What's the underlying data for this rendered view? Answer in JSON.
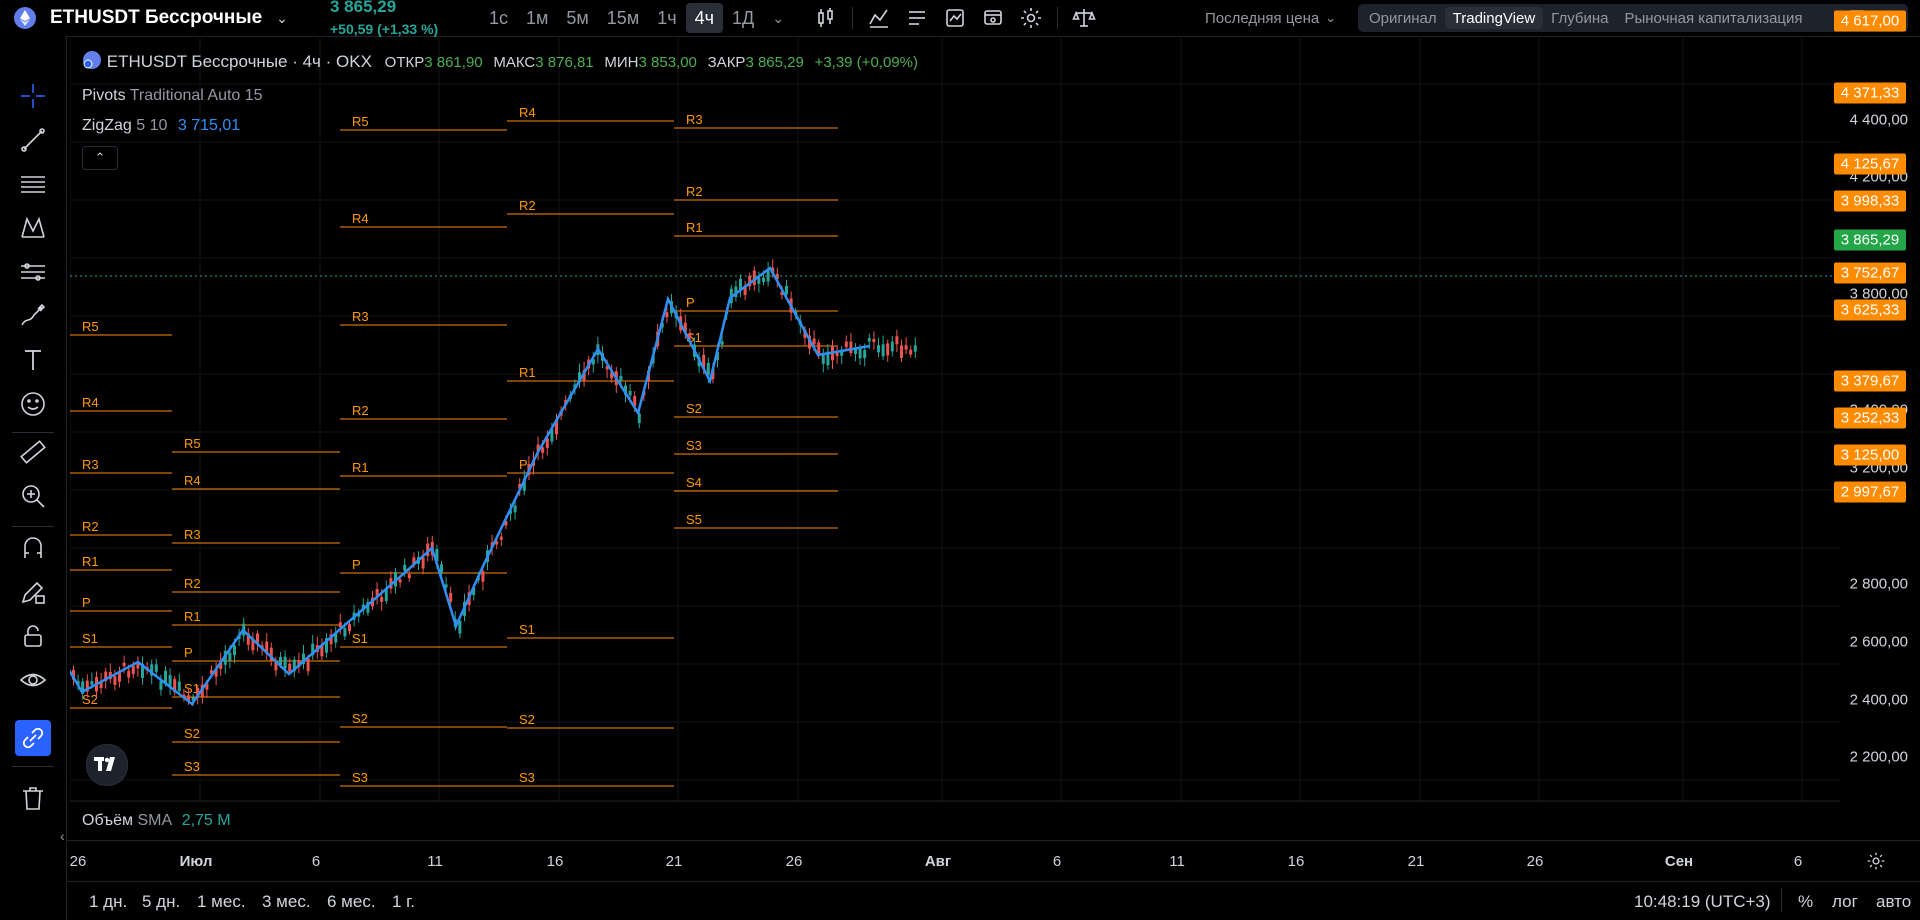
{
  "header": {
    "symbol": "ETHUSDT Бессрочные",
    "last_price": "3 865,29",
    "change": "+50,59 (+1,33 %)",
    "timeframes": [
      "1с",
      "1м",
      "5м",
      "15м",
      "1ч",
      "4ч",
      "1Д"
    ],
    "active_timeframe": "4ч",
    "price_mode": "Последняя цена",
    "view_tabs": [
      "Оригинал",
      "TradingView",
      "Глубина",
      "Рыночная капитализация"
    ],
    "active_view": "TradingView"
  },
  "legend": {
    "title": "ETHUSDT Бессрочные · 4ч · OKX",
    "open_label": "ОТКР",
    "open": "3 861,90",
    "high_label": "МАКС",
    "high": "3 876,81",
    "low_label": "МИН",
    "low": "3 853,00",
    "close_label": "ЗАКР",
    "close": "3 865,29",
    "change": "+3,39 (+0,09%)"
  },
  "indicators": {
    "pivots_name": "Pivots",
    "pivots_params": "Traditional Auto 15",
    "zigzag_name": "ZigZag",
    "zigzag_params": "5 10",
    "zigzag_value": "3 715,01",
    "volume_name": "Объём",
    "volume_ma": "SMA",
    "volume_value": "2,75 M"
  },
  "price_axis": {
    "labels": [
      "4 400,00",
      "4 200,00",
      "3 800,00",
      "3 400,00",
      "3 200,00",
      "2 800,00",
      "2 600,00",
      "2 400,00",
      "2 200,00"
    ],
    "tags": [
      {
        "text": "4 617,00",
        "color": "#ff8c00"
      },
      {
        "text": "4 371,33",
        "color": "#ff8c00"
      },
      {
        "text": "4 125,67",
        "color": "#ff8c00"
      },
      {
        "text": "3 998,33",
        "color": "#ff8c00"
      },
      {
        "text": "3 865,29",
        "color": "#22a647"
      },
      {
        "text": "3 752,67",
        "color": "#ff8c00"
      },
      {
        "text": "3 625,33",
        "color": "#ff8c00"
      },
      {
        "text": "3 379,67",
        "color": "#ff8c00"
      },
      {
        "text": "3 252,33",
        "color": "#ff8c00"
      },
      {
        "text": "3 125,00",
        "color": "#ff8c00"
      },
      {
        "text": "2 997,67",
        "color": "#ff8c00"
      }
    ]
  },
  "time_axis": [
    "26",
    "Июл",
    "6",
    "11",
    "16",
    "21",
    "26",
    "Авг",
    "6",
    "11",
    "16",
    "21",
    "26",
    "Сен",
    "6"
  ],
  "range_buttons": [
    "1 дн.",
    "5 дн.",
    "1 мес.",
    "3 мес.",
    "6 мес.",
    "1 г."
  ],
  "clock": "10:48:19 (UTC+3)",
  "scale_buttons": [
    "%",
    "лог",
    "авто"
  ],
  "pivot_levels": {
    "p1": [
      "R5",
      "R4",
      "R3",
      "R2",
      "R1",
      "P",
      "S1",
      "S2"
    ],
    "p2": [
      "R5",
      "R4",
      "R3",
      "R2",
      "R1",
      "P",
      "S1",
      "S2",
      "S3"
    ],
    "p3": [
      "R5",
      "R4",
      "R3",
      "R2",
      "R1",
      "P",
      "S1",
      "S2",
      "S3"
    ],
    "p4": [
      "R4",
      "R2",
      "R1",
      "P",
      "S1",
      "S2",
      "S3"
    ],
    "p5": [
      "R3",
      "R2",
      "R1",
      "P",
      "S1",
      "S2",
      "S3",
      "S4",
      "S5"
    ]
  },
  "tools": [
    "crosshair-icon",
    "trend-line-icon",
    "fib-icon",
    "pattern-icon",
    "prediction-icon",
    "brush-icon",
    "text-icon",
    "emoji-icon",
    "ruler-icon",
    "zoom-icon",
    "magnet-icon",
    "lock-pencil-icon",
    "lock-icon",
    "eye-icon",
    "link-icon",
    "trash-icon"
  ]
}
